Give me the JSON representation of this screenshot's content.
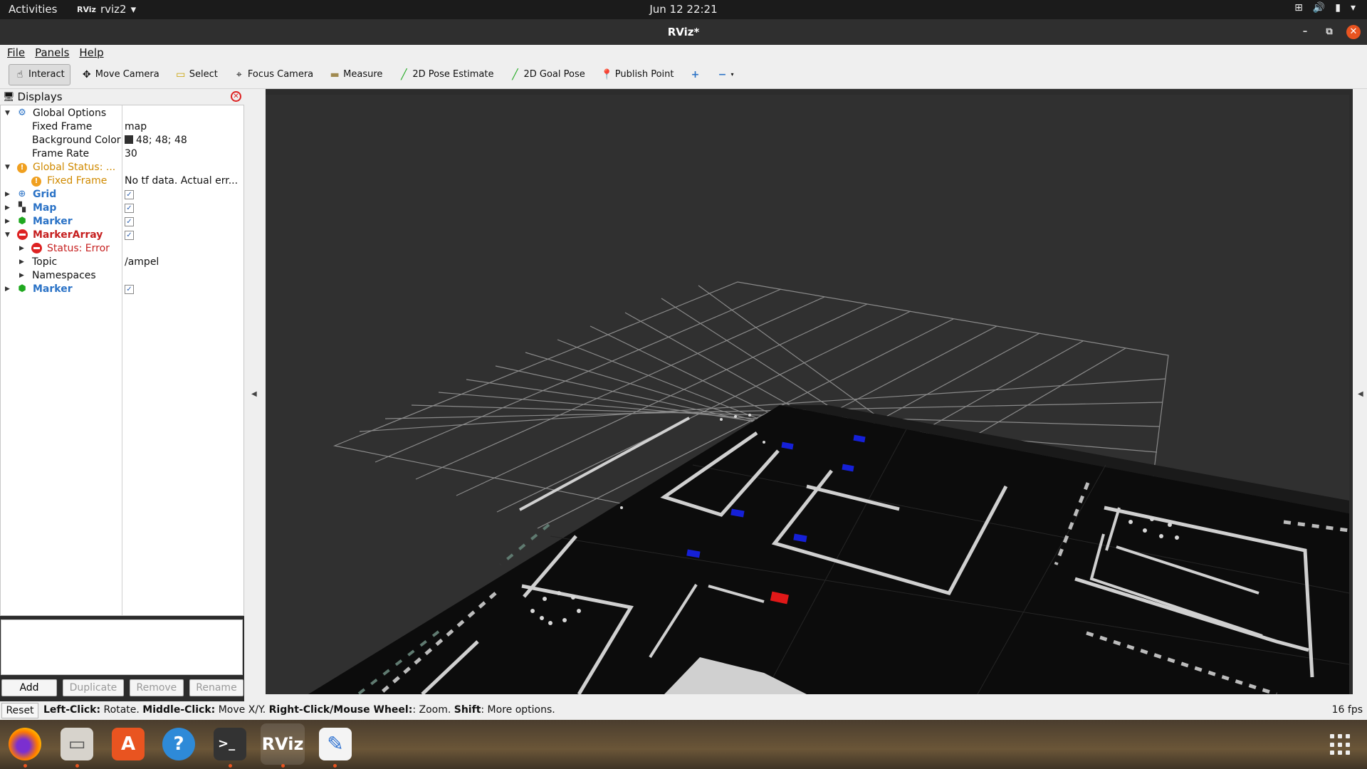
{
  "topbar": {
    "activities": "Activities",
    "app_icon": "RViz",
    "app_name": "rviz2",
    "clock": "Jun 12  22:21",
    "tray_icons": [
      "network-icon",
      "volume-icon",
      "battery-icon"
    ]
  },
  "window": {
    "title": "RViz*"
  },
  "menu": {
    "file": "File",
    "panels": "Panels",
    "help": "Help"
  },
  "toolbar": {
    "interact": "Interact",
    "move_camera": "Move Camera",
    "select": "Select",
    "focus_camera": "Focus Camera",
    "measure": "Measure",
    "pose_estimate": "2D Pose Estimate",
    "goal_pose": "2D Goal Pose",
    "publish_point": "Publish Point"
  },
  "displays": {
    "title": "Displays",
    "global_options": "Global Options",
    "fixed_frame_label": "Fixed Frame",
    "fixed_frame_value": "map",
    "bg_color_label": "Background Color",
    "bg_color_value": "48; 48; 48",
    "frame_rate_label": "Frame Rate",
    "frame_rate_value": "30",
    "global_status": "Global Status: ...",
    "status_fixed_frame": "Fixed Frame",
    "status_fixed_frame_value": "No tf data.  Actual err...",
    "grid": "Grid",
    "map": "Map",
    "marker": "Marker",
    "marker_array": "MarkerArray",
    "status_error": "Status: Error",
    "topic_label": "Topic",
    "topic_value": "/ampel",
    "namespaces": "Namespaces",
    "marker2": "Marker"
  },
  "panel_buttons": {
    "add": "Add",
    "duplicate": "Duplicate",
    "remove": "Remove",
    "rename": "Rename"
  },
  "status": {
    "reset": "Reset",
    "left_click": "Left-Click:",
    "left_action": " Rotate. ",
    "middle_click": "Middle-Click:",
    "middle_action": " Move X/Y. ",
    "right_click": "Right-Click/Mouse Wheel:",
    "right_action": ": Zoom. ",
    "shift": "Shift",
    "shift_action": ": More options.",
    "fps": "16 fps"
  },
  "dock": {
    "apps": [
      "firefox-icon",
      "files-icon",
      "software-icon",
      "help-icon",
      "terminal-icon",
      "rviz-icon",
      "text-editor-icon"
    ],
    "rviz_label": "RViz"
  },
  "colors": {
    "background": "#303030",
    "accent": "#e95420"
  }
}
